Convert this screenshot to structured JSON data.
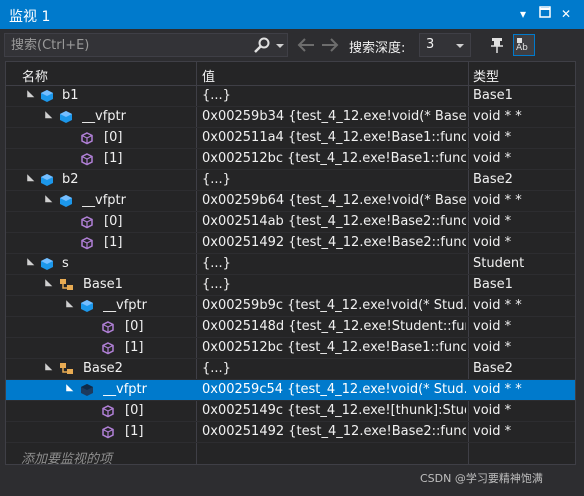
{
  "window": {
    "title": "监视 1",
    "dropdown_icon": "chevron-down-icon",
    "maximize_icon": "maximize-icon",
    "close_icon": "close-icon"
  },
  "toolbar": {
    "search_placeholder": "搜索(Ctrl+E)",
    "search_icon": "search-icon",
    "depth_label": "搜索深度:",
    "depth_value": "3"
  },
  "columns": {
    "name": "名称",
    "value": "值",
    "type": "类型"
  },
  "rows": [
    {
      "name": "b1",
      "value": "{...}",
      "type": "Base1"
    },
    {
      "name": "__vfptr",
      "value": "0x00259b34 {test_4_12.exe!void(* Base...",
      "type": "void * *"
    },
    {
      "name": "[0]",
      "value": "0x002511a4 {test_4_12.exe!Base1::func...",
      "type": "void *"
    },
    {
      "name": "[1]",
      "value": "0x002512bc {test_4_12.exe!Base1::func...",
      "type": "void *"
    },
    {
      "name": "b2",
      "value": "{...}",
      "type": "Base2"
    },
    {
      "name": "__vfptr",
      "value": "0x00259b64 {test_4_12.exe!void(* Base...",
      "type": "void * *"
    },
    {
      "name": "[0]",
      "value": "0x002514ab {test_4_12.exe!Base2::func...",
      "type": "void *"
    },
    {
      "name": "[1]",
      "value": "0x00251492 {test_4_12.exe!Base2::func...",
      "type": "void *"
    },
    {
      "name": "s",
      "value": "{...}",
      "type": "Student"
    },
    {
      "name": "Base1",
      "value": "{...}",
      "type": "Base1"
    },
    {
      "name": "__vfptr",
      "value": "0x00259b9c {test_4_12.exe!void(* Stud...",
      "type": "void * *"
    },
    {
      "name": "[0]",
      "value": "0x0025148d {test_4_12.exe!Student::func...",
      "type": "void *"
    },
    {
      "name": "[1]",
      "value": "0x002512bc {test_4_12.exe!Base1::func...",
      "type": "void *"
    },
    {
      "name": "Base2",
      "value": "{...}",
      "type": "Base2"
    },
    {
      "name": "__vfptr",
      "value": "0x00259c54 {test_4_12.exe!void(* Stud...",
      "type": "void * *"
    },
    {
      "name": "[0]",
      "value": "0x0025149c {test_4_12.exe![thunk]:Stud...",
      "type": "void *"
    },
    {
      "name": "[1]",
      "value": "0x00251492 {test_4_12.exe!Base2::func...",
      "type": "void *"
    }
  ],
  "add_watch_placeholder": "添加要监视的项",
  "watermark": "CSDN @学习要精神饱满"
}
